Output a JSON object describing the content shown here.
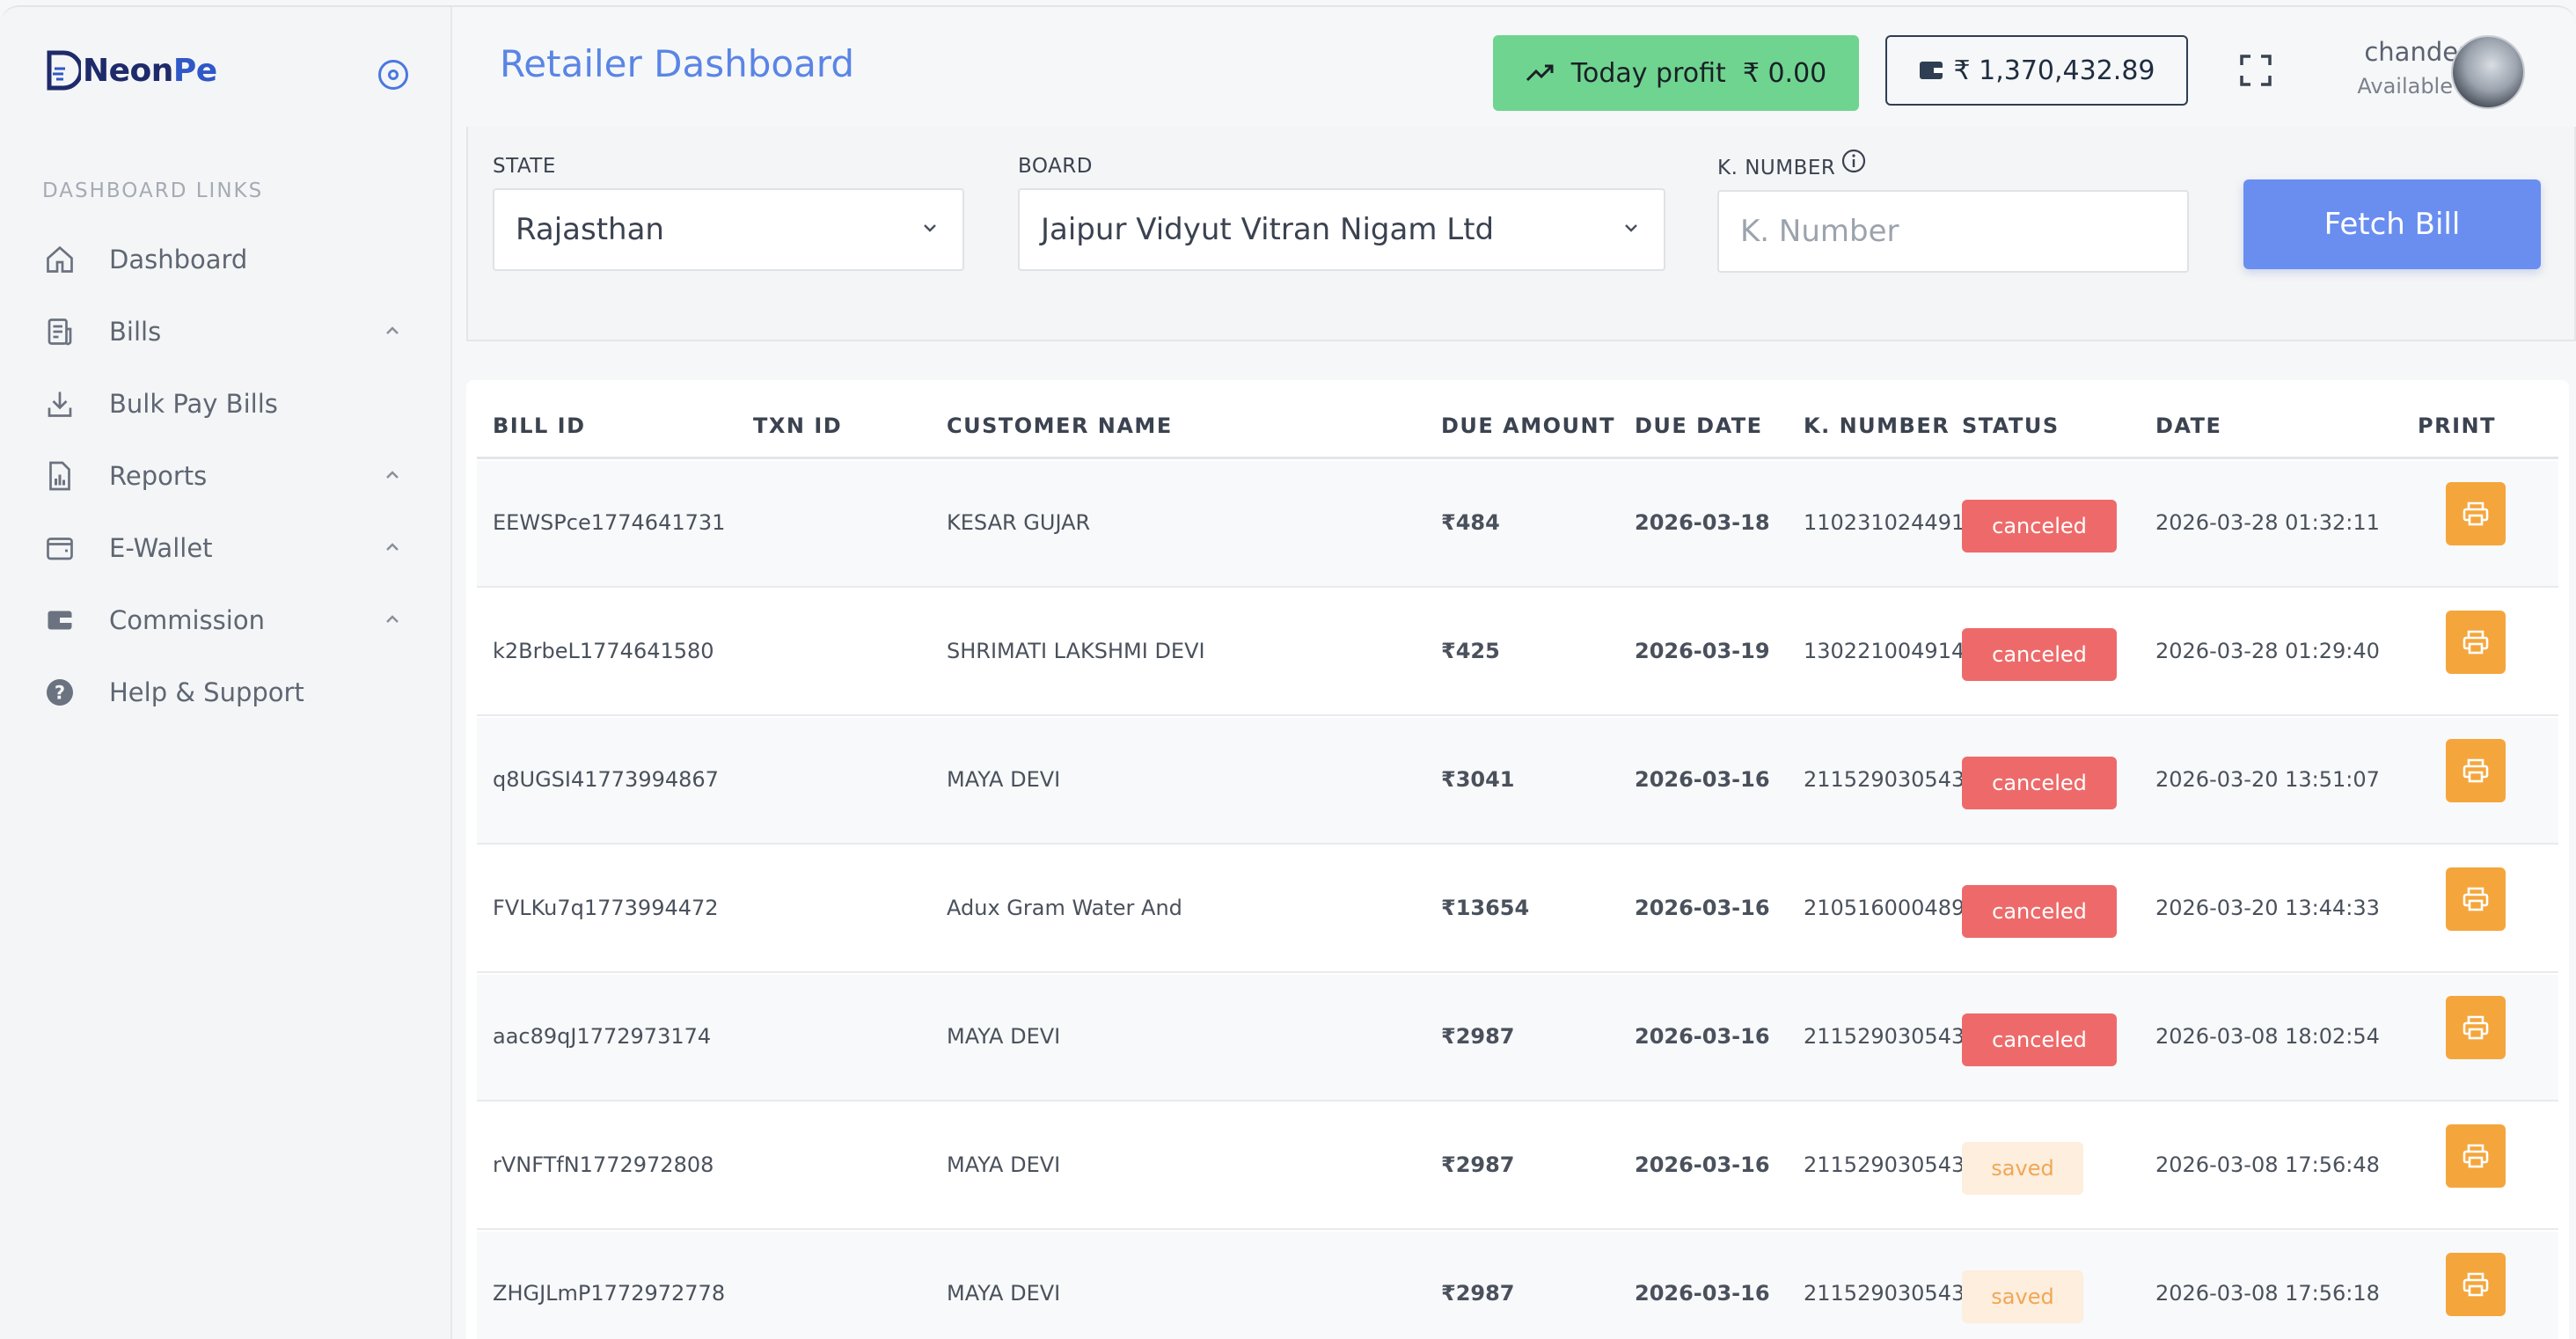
{
  "brand": {
    "name_main": "Neon",
    "name_accent": "Pe"
  },
  "sidebar": {
    "heading": "DASHBOARD LINKS",
    "items": [
      {
        "label": "Dashboard",
        "icon": "home-icon",
        "expandable": false
      },
      {
        "label": "Bills",
        "icon": "bills-icon",
        "expandable": true
      },
      {
        "label": "Bulk Pay Bills",
        "icon": "download-tray-icon",
        "expandable": false
      },
      {
        "label": "Reports",
        "icon": "report-chart-icon",
        "expandable": true
      },
      {
        "label": "E-Wallet",
        "icon": "wallet-icon",
        "expandable": true
      },
      {
        "label": "Commission",
        "icon": "card-icon",
        "expandable": true
      },
      {
        "label": "Help & Support",
        "icon": "help-circle-icon",
        "expandable": false
      }
    ]
  },
  "header": {
    "title": "Retailer Dashboard",
    "profit_label": "Today profit",
    "profit_value": "₹ 0.00",
    "wallet_balance": "₹ 1,370,432.89",
    "user_name": "chander",
    "user_status": "Available"
  },
  "form": {
    "state_label": "STATE",
    "state_value": "Rajasthan",
    "board_label": "BOARD",
    "board_value": "Jaipur Vidyut Vitran Nigam Ltd",
    "knumber_label": "K. NUMBER",
    "knumber_placeholder": "K. Number",
    "fetch_label": "Fetch Bill"
  },
  "table": {
    "headers": [
      "BILL ID",
      "TXN ID",
      "CUSTOMER NAME",
      "DUE AMOUNT",
      "DUE DATE",
      "K. NUMBER",
      "STATUS",
      "DATE",
      "PRINT"
    ],
    "rows": [
      {
        "bill_id": "EEWSPce1774641731",
        "txn_id": "",
        "customer": "KESAR GUJAR",
        "amount": "₹484",
        "due_date": "2026-03-18",
        "knumber": "110231024491",
        "status": "canceled",
        "date": "2026-03-28 01:32:11"
      },
      {
        "bill_id": "k2BrbeL1774641580",
        "txn_id": "",
        "customer": "SHRIMATI LAKSHMI DEVI",
        "amount": "₹425",
        "due_date": "2026-03-19",
        "knumber": "130221004914",
        "status": "canceled",
        "date": "2026-03-28 01:29:40"
      },
      {
        "bill_id": "q8UGSI41773994867",
        "txn_id": "",
        "customer": "MAYA DEVI",
        "amount": "₹3041",
        "due_date": "2026-03-16",
        "knumber": "211529030543",
        "status": "canceled",
        "date": "2026-03-20 13:51:07"
      },
      {
        "bill_id": "FVLKu7q1773994472",
        "txn_id": "",
        "customer": "Adux Gram Water And",
        "amount": "₹13654",
        "due_date": "2026-03-16",
        "knumber": "210516000489",
        "status": "canceled",
        "date": "2026-03-20 13:44:33"
      },
      {
        "bill_id": "aac89qJ1772973174",
        "txn_id": "",
        "customer": "MAYA DEVI",
        "amount": "₹2987",
        "due_date": "2026-03-16",
        "knumber": "211529030543",
        "status": "canceled",
        "date": "2026-03-08 18:02:54"
      },
      {
        "bill_id": "rVNFTfN1772972808",
        "txn_id": "",
        "customer": "MAYA DEVI",
        "amount": "₹2987",
        "due_date": "2026-03-16",
        "knumber": "211529030543",
        "status": "saved",
        "date": "2026-03-08 17:56:48"
      },
      {
        "bill_id": "ZHGJLmP1772972778",
        "txn_id": "",
        "customer": "MAYA DEVI",
        "amount": "₹2987",
        "due_date": "2026-03-16",
        "knumber": "211529030543",
        "status": "saved",
        "date": "2026-03-08 17:56:18"
      }
    ]
  },
  "colors": {
    "accent": "#5a85e6",
    "profit_bg": "#6fd48f",
    "canceled": "#ee6a6a",
    "saved_bg": "#fdeedd",
    "saved_text": "#f0a756",
    "print": "#f4a63c"
  }
}
